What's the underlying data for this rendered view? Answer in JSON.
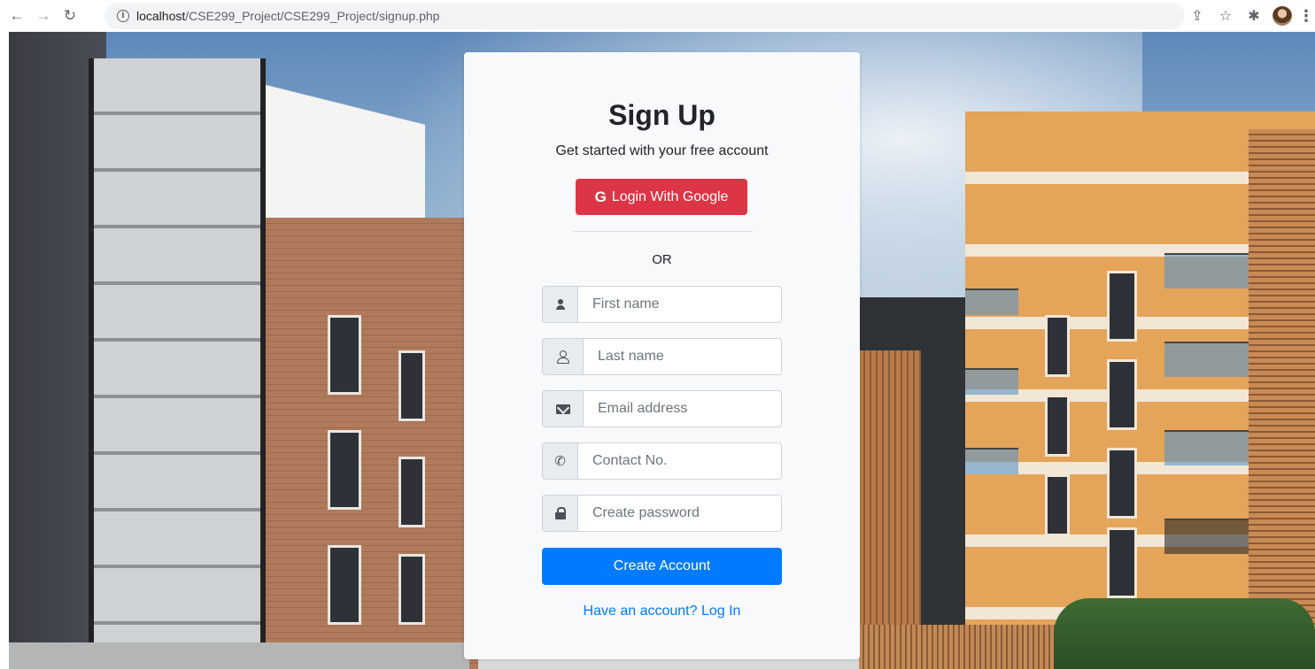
{
  "browser": {
    "url_host": "localhost",
    "url_path": "/CSE299_Project/CSE299_Project/signup.php",
    "icons": [
      "back-arrow-icon",
      "forward-arrow-icon",
      "reload-icon",
      "info-icon",
      "share-icon",
      "star-icon",
      "extensions-icon",
      "profile-avatar",
      "menu-kebab-icon"
    ]
  },
  "signup": {
    "title": "Sign Up",
    "subtitle": "Get started with your free account",
    "google_button": {
      "icon": "G",
      "label": "Login With Google"
    },
    "separator": "OR",
    "fields": [
      {
        "placeholder": "First name",
        "value": "",
        "icon": "user-icon"
      },
      {
        "placeholder": "Last name",
        "value": "",
        "icon": "user-outline-icon"
      },
      {
        "placeholder": "Email address",
        "value": "",
        "icon": "envelope-icon"
      },
      {
        "placeholder": "Contact No.",
        "value": "",
        "icon": "phone-icon"
      },
      {
        "placeholder": "Create password",
        "value": "",
        "icon": "lock-icon"
      }
    ],
    "submit_label": "Create Account",
    "login_link": "Have an account? Log In"
  },
  "colors": {
    "google_red": "#dc3545",
    "primary_blue": "#007bff",
    "card_bg": "#f8f9fa"
  }
}
